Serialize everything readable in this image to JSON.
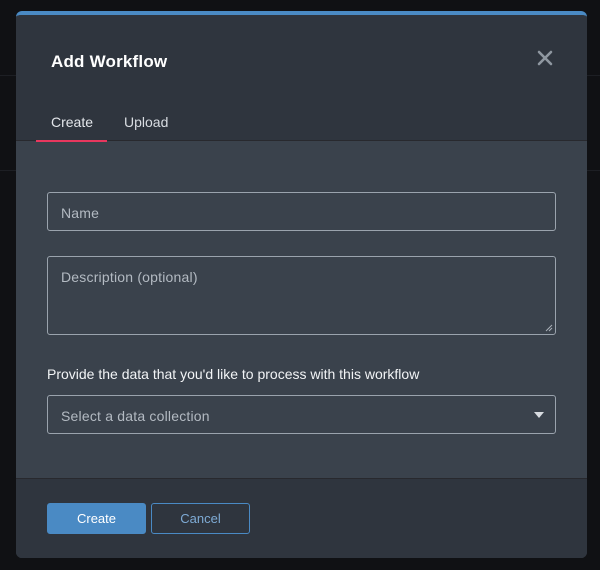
{
  "modal": {
    "title": "Add Workflow",
    "tabs": [
      {
        "label": "Create",
        "active": true
      },
      {
        "label": "Upload",
        "active": false
      }
    ],
    "close_icon": "close-icon"
  },
  "form": {
    "name_placeholder": "Name",
    "description_placeholder": "Description (optional)",
    "data_prompt": "Provide the data that you'd like to process with this workflow",
    "data_collection_placeholder": "Select a data collection"
  },
  "footer": {
    "create_label": "Create",
    "cancel_label": "Cancel"
  },
  "colors": {
    "accent": "#4a8ac4",
    "tab_indicator": "#e8375e",
    "header_bg": "#2f353e",
    "body_bg": "#3a424c"
  }
}
